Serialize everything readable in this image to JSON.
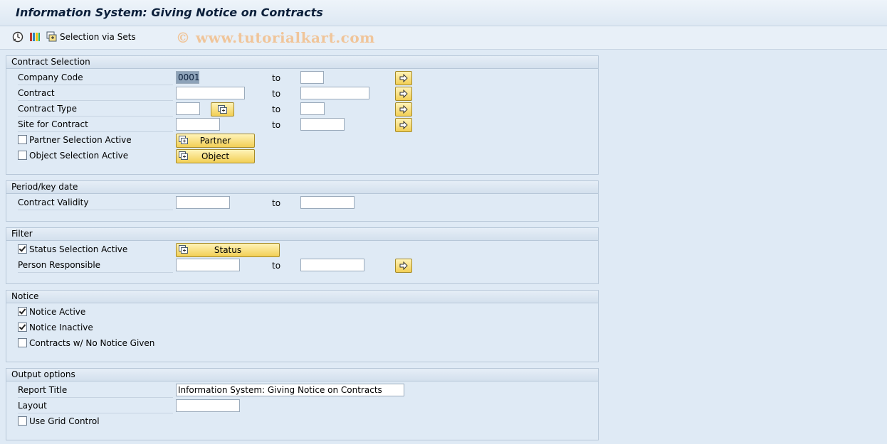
{
  "window": {
    "title": "Information System: Giving Notice on Contracts"
  },
  "toolbar": {
    "execute_icon": "execute-clock-icon",
    "variants_icon": "multicolor-variant-icon",
    "selection_sets_label": "Selection via Sets",
    "watermark": "© www.tutorialkart.com"
  },
  "contract_selection": {
    "header": "Contract Selection",
    "company_code": {
      "label": "Company Code",
      "from": "0001",
      "to_label": "to",
      "to": ""
    },
    "contract": {
      "label": "Contract",
      "from": "",
      "to_label": "to",
      "to": ""
    },
    "contract_type": {
      "label": "Contract Type",
      "from": "",
      "to_label": "to",
      "to": ""
    },
    "site": {
      "label": "Site for Contract",
      "from": "",
      "to_label": "to",
      "to": ""
    },
    "partner": {
      "label": "Partner Selection Active",
      "checked": false,
      "button": "Partner"
    },
    "object": {
      "label": "Object Selection Active",
      "checked": false,
      "button": "Object"
    }
  },
  "period": {
    "header": "Period/key date",
    "validity": {
      "label": "Contract Validity",
      "from": "",
      "to_label": "to",
      "to": ""
    }
  },
  "filter": {
    "header": "Filter",
    "status": {
      "label": "Status Selection Active",
      "checked": true,
      "button": "Status"
    },
    "person": {
      "label": "Person Responsible",
      "from": "",
      "to_label": "to",
      "to": ""
    }
  },
  "notice": {
    "header": "Notice",
    "active": {
      "label": "Notice Active",
      "checked": true
    },
    "inactive": {
      "label": "Notice Inactive",
      "checked": true
    },
    "none": {
      "label": "Contracts w/ No Notice Given",
      "checked": false
    }
  },
  "output": {
    "header": "Output options",
    "report_title": {
      "label": "Report Title",
      "value": "Information System: Giving Notice on Contracts"
    },
    "layout": {
      "label": "Layout",
      "value": ""
    },
    "grid": {
      "label": "Use Grid Control",
      "checked": false
    }
  },
  "colors": {
    "background": "#dfeaf5",
    "button": "#f2cf55",
    "watermark": "#f0c59a"
  }
}
